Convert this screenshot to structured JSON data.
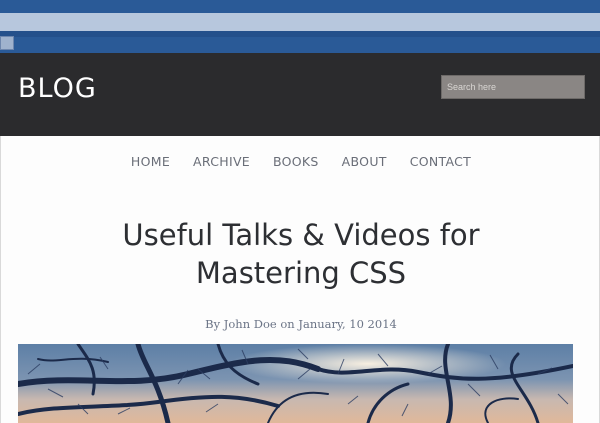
{
  "header": {
    "logo": "BLOG",
    "search_placeholder": "Search here"
  },
  "nav": {
    "items": [
      "HOME",
      "ARCHIVE",
      "BOOKS",
      "ABOUT",
      "CONTACT"
    ]
  },
  "post": {
    "title_line1": "Useful Talks & Videos for",
    "title_line2": "Mastering CSS",
    "byline": "By John Doe on January, 10 2014"
  },
  "colors": {
    "browser_blue": "#2a5a97",
    "header_bg": "#2b2b2d",
    "nav_text": "#6a6e78",
    "title_text": "#2d2f33",
    "byline_text": "#6b7486"
  }
}
